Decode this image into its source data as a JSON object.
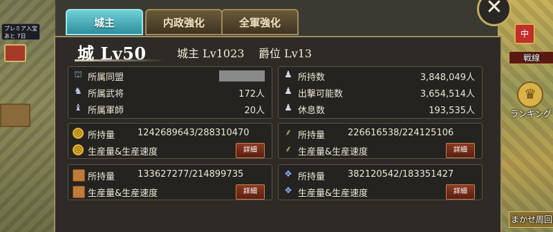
{
  "tabs": [
    {
      "label": "城主",
      "active": true
    },
    {
      "label": "内政強化",
      "active": false
    },
    {
      "label": "全軍強化",
      "active": false
    }
  ],
  "header": {
    "castle_level": "城 Lv50",
    "lord_level": "城主 Lv1023",
    "rank_level": "爵位 Lv13"
  },
  "affiliation": {
    "alliance_label": "所属同盟",
    "generals_label": "所属武将",
    "generals_value": "172人",
    "strategists_label": "所属軍師",
    "strategists_value": "20人"
  },
  "troops": {
    "owned_label": "所持数",
    "owned_value": "3,848,049人",
    "sortie_label": "出撃可能数",
    "sortie_value": "3,654,514人",
    "rest_label": "休息数",
    "rest_value": "193,535人"
  },
  "resources": {
    "gold": {
      "owned_label": "所持量",
      "owned_value": "1242689643/288310470",
      "production_label": "生産量&生産速度",
      "detail_label": "詳細"
    },
    "food": {
      "owned_label": "所持量",
      "owned_value": "226616538/224125106",
      "production_label": "生産量&生産速度",
      "detail_label": "詳細"
    },
    "wood": {
      "owned_label": "所持量",
      "owned_value": "133627277/214899735",
      "production_label": "生産量&生産速度",
      "detail_label": "詳細"
    },
    "iron": {
      "owned_label": "所持量",
      "owned_value": "382120542/183351427",
      "production_label": "生産量&生産速度",
      "detail_label": "詳細"
    }
  },
  "side": {
    "front_label": "戦線",
    "ranking_label": "ランキング",
    "auto_label": "まかせ周回",
    "badge_text": "プレミア入宝 あと 7日"
  },
  "close_label": "✕",
  "icons": {
    "alliance": "castle-icon",
    "generals": "general-icon",
    "strategists": "strategist-icon",
    "troops": "soldier-icon",
    "gold": "coin-icon",
    "food": "wheat-icon",
    "wood": "wood-icon",
    "iron": "ore-icon"
  }
}
